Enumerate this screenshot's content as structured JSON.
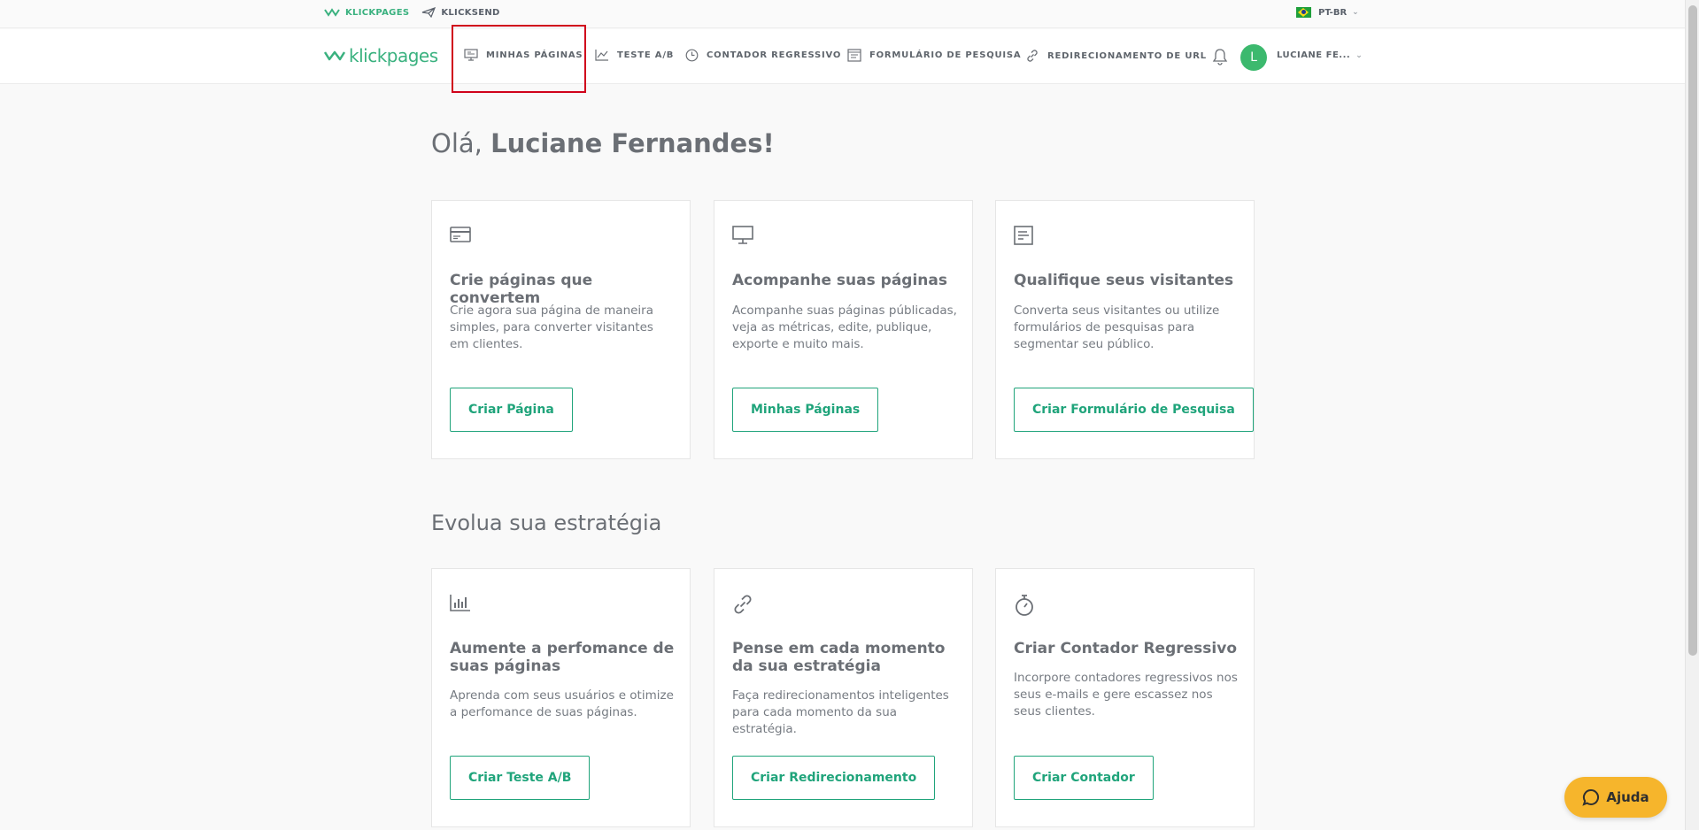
{
  "topbar": {
    "links": [
      {
        "label": "KLICKPAGES",
        "icon": "klickpages-logo-icon"
      },
      {
        "label": "KLICKSEND",
        "icon": "paper-plane-icon"
      }
    ],
    "language": {
      "label": "PT-BR",
      "icon": "brazil-flag-icon"
    }
  },
  "nav": {
    "logo_text": "klickpages",
    "items": [
      {
        "label": "MINHAS PÁGINAS",
        "icon": "monitor-icon"
      },
      {
        "label": "TESTE A/B",
        "icon": "line-chart-icon"
      },
      {
        "label": "CONTADOR REGRESSIVO",
        "icon": "clock-icon"
      },
      {
        "label": "FORMULÁRIO DE PESQUISA",
        "icon": "form-icon"
      },
      {
        "label": "REDIRECIONAMENTO DE URL",
        "icon": "link-icon"
      }
    ],
    "avatar_initial": "L",
    "user_name": "LUCIANE FE..."
  },
  "greeting": {
    "prefix": "Olá, ",
    "name": "Luciane Fernandes!"
  },
  "cards_top": [
    {
      "icon": "credit-card-icon",
      "title": "Crie páginas que convertem",
      "text": "Crie agora sua página de maneira simples, para converter visitantes em clientes.",
      "button": "Criar Página"
    },
    {
      "icon": "monitor-icon",
      "title": "Acompanhe suas páginas",
      "text": "Acompanhe suas páginas públicadas, veja as métricas, edite, publique, exporte e muito mais.",
      "button": "Minhas Páginas"
    },
    {
      "icon": "document-icon",
      "title": "Qualifique seus visitantes",
      "text": "Converta seus visitantes ou utilize formulários de pesquisas para segmentar seu público.",
      "button": "Criar Formulário de Pesquisa"
    }
  ],
  "section_title": "Evolua sua estratégia",
  "cards_bottom": [
    {
      "icon": "bar-chart-icon",
      "title": "Aumente a perfomance de suas páginas",
      "text": "Aprenda com seus usuários e otimize a perfomance de suas páginas.",
      "button": "Criar Teste A/B"
    },
    {
      "icon": "link-icon",
      "title": "Pense em cada momento da sua estratégia",
      "text": "Faça redirecionamentos inteligentes para cada momento da sua estratégia.",
      "button": "Criar Redirecionamento"
    },
    {
      "icon": "stopwatch-icon",
      "title": "Criar Contador Regressivo",
      "text": "Incorpore contadores regressivos nos seus e-mails e gere escassez nos seus clientes.",
      "button": "Criar Contador"
    }
  ],
  "help_button": "Ajuda",
  "colors": {
    "brand_green": "#3ab17f",
    "button_green": "#20a47b",
    "help_yellow": "#f6b52c",
    "highlight_red": "#d0021b"
  }
}
